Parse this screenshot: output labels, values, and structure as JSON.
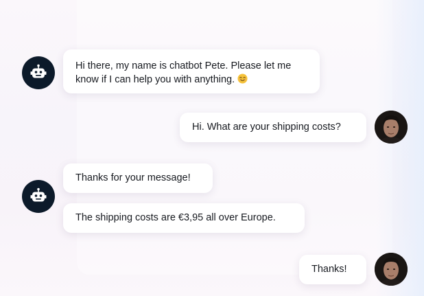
{
  "chat": {
    "messages": [
      {
        "sender": "bot",
        "line1": "Hi there, my name is chatbot Pete. Please let me",
        "line2": "know if I can help you with anything.",
        "emoji": "smiling-face-emoji"
      },
      {
        "sender": "user",
        "text": "Hi. What are your shipping costs?"
      },
      {
        "sender": "bot",
        "text": "Thanks for your message!"
      },
      {
        "sender": "bot",
        "text": "The shipping costs are €3,95 all over Europe."
      },
      {
        "sender": "user",
        "text": "Thanks!"
      }
    ]
  },
  "colors": {
    "bot_avatar_bg": "#0c1a2a",
    "bubble_bg": "#ffffff",
    "text": "#16191f"
  },
  "icons": {
    "bot": "robot-icon",
    "user": "user-photo-avatar"
  }
}
